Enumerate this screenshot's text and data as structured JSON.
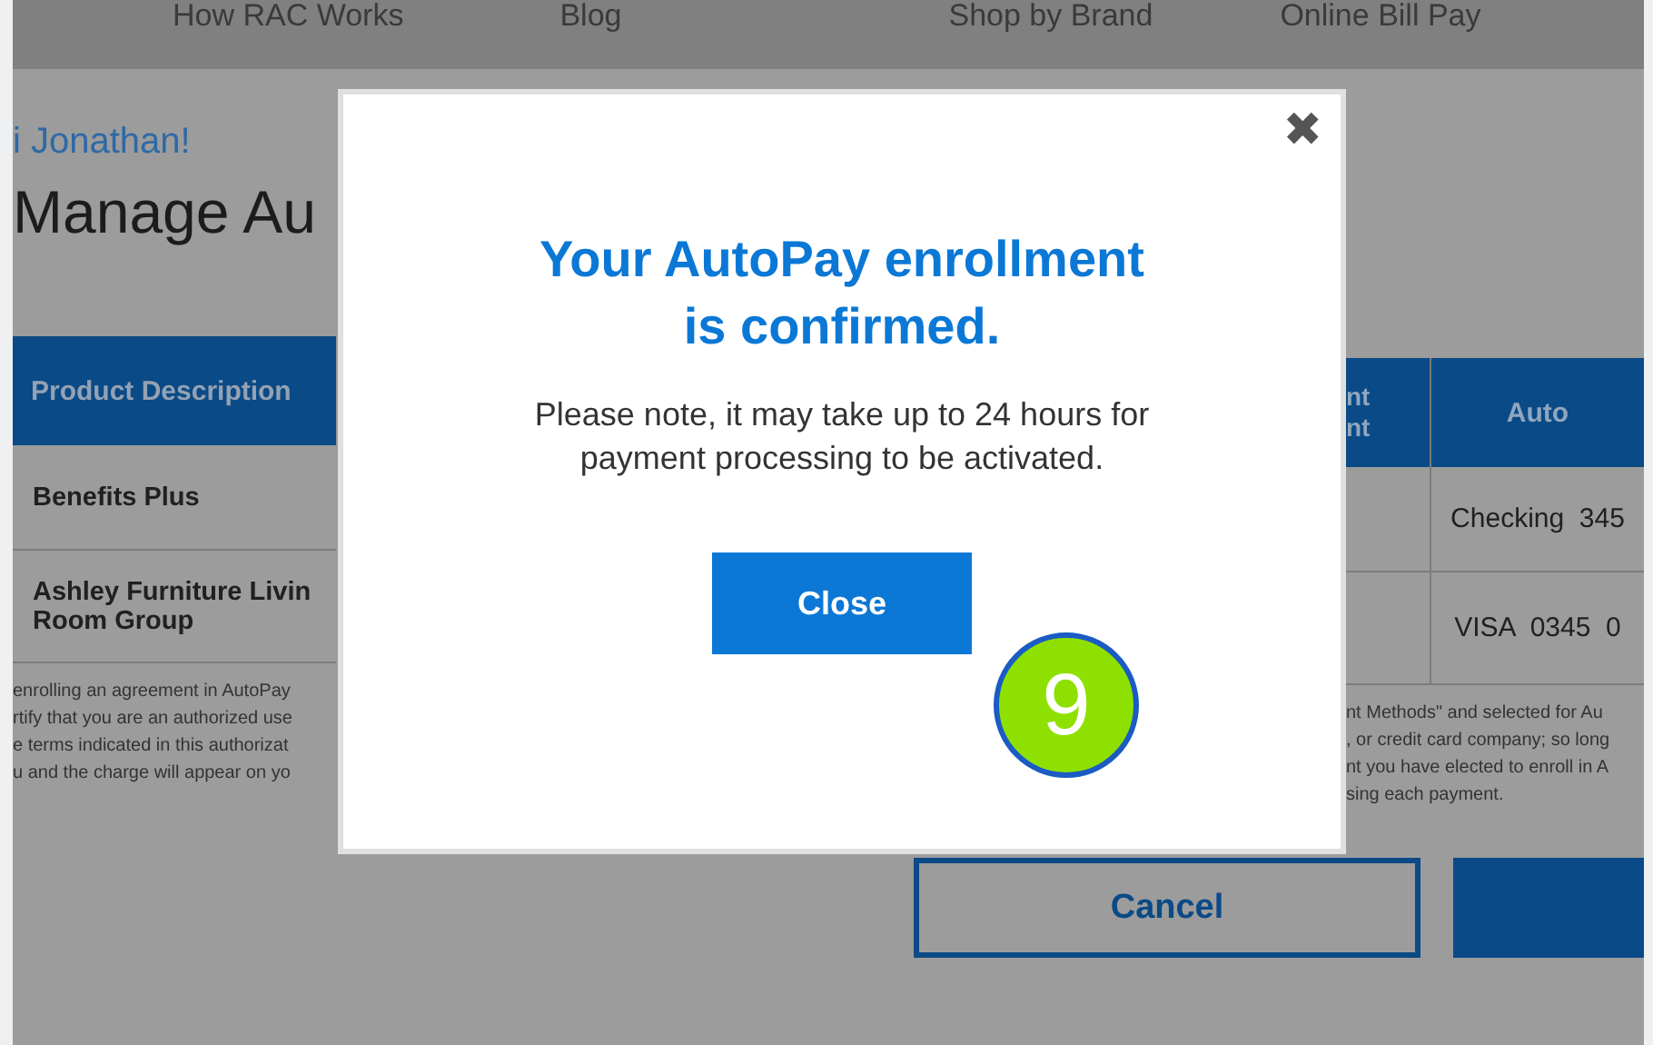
{
  "nav": {
    "items": [
      "How RAC Works",
      "Blog",
      "Shop by Brand",
      "Online Bill Pay"
    ]
  },
  "greeting": "i Jonathan!",
  "page_title": "Manage Au",
  "table": {
    "column_1": "Product Description",
    "column_2": [
      "nt",
      "nt"
    ],
    "column_3": "Auto",
    "rows": [
      {
        "column_1": [
          "Benefits Plus"
        ],
        "column_3": "Checking  345"
      },
      {
        "column_1": [
          "Ashley Furniture Livin",
          "Room Group"
        ],
        "column_3": "VISA  0345  0"
      }
    ]
  },
  "legal": {
    "left_lines": [
      "enrolling an agreement in AutoPay",
      "rtify that you are an authorized use",
      "e terms indicated in this authorizat",
      "u and the charge will appear on yo"
    ],
    "right_lines": [
      "nt Methods\" and selected for Au",
      ", or credit card company; so long",
      "nt you have elected to enroll in A",
      "sing each payment."
    ]
  },
  "buttons": [
    {
      "label": "Cancel",
      "kind": "outline"
    },
    {
      "kind": "solid"
    }
  ],
  "modal": {
    "close": "✖",
    "title_lines": [
      "Your AutoPay enrollment",
      "is confirmed."
    ],
    "body_lines": [
      "Please note, it may take up to 24 hours for",
      "payment processing to be activated."
    ],
    "button": "Close"
  },
  "step_badge": "9"
}
